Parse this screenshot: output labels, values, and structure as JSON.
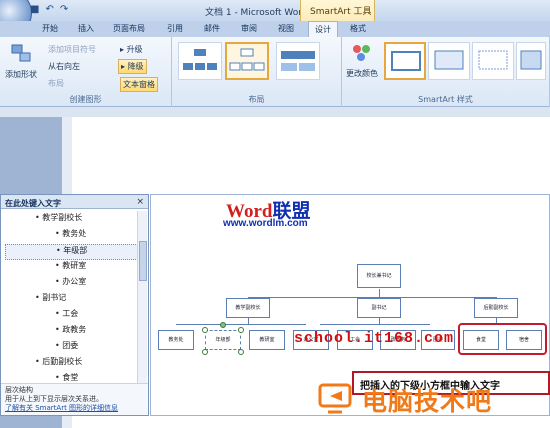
{
  "window": {
    "title": "文档 1 - Microsoft Word",
    "context_group": "SmartArt 工具"
  },
  "tabs": [
    "开始",
    "插入",
    "页面布局",
    "引用",
    "邮件",
    "审阅",
    "视图",
    "设计",
    "格式"
  ],
  "ribbon": {
    "create_graphic": {
      "label": "创建图形",
      "add_bullet": "添加项目符号",
      "right_to_left": "从右向左",
      "layout": "布局",
      "add_shape": "添加形状",
      "promote": "升级",
      "demote": "降级",
      "text_pane": "文本窗格"
    },
    "layouts": {
      "label": "布局"
    },
    "styles": {
      "label": "SmartArt 样式",
      "change_colors": "更改颜色"
    }
  },
  "text_pane": {
    "title": "在此处键入文字",
    "close": "×",
    "items": [
      "教学副校长",
      "教务处",
      "年级部",
      "教研室",
      "办公室",
      "副书记",
      "工会",
      "政教务",
      "团委",
      "后勤副校长",
      "食堂"
    ],
    "description_title": "层次结构",
    "description": "用于从上到下显示层次关系进。",
    "link": "了解有关 SmartArt 图形的详细信息"
  },
  "diagram": {
    "brand": {
      "word": "Word",
      "cn": "联盟",
      "url": "www.wordlm.com"
    },
    "root": "校长兼书记",
    "level2": [
      "教学副校长",
      "副书记",
      "后勤副校长"
    ],
    "level3": [
      "教务处",
      "年级部",
      "教研室",
      "办公室",
      "工会",
      "政教务",
      "团委",
      "食堂",
      "宿舍"
    ]
  },
  "overlays": {
    "watermark_site": "school.it168.com",
    "callout": "把插入的下级小方框中输入文字",
    "watermark_brand": "电脑技术吧"
  },
  "colors": {
    "accent": "#e6a83c",
    "node_border": "#5b7fb5",
    "red": "#c21a2e",
    "orange": "#f07a1a",
    "brand_red": "#d02020",
    "brand_blue": "#1030b0"
  }
}
